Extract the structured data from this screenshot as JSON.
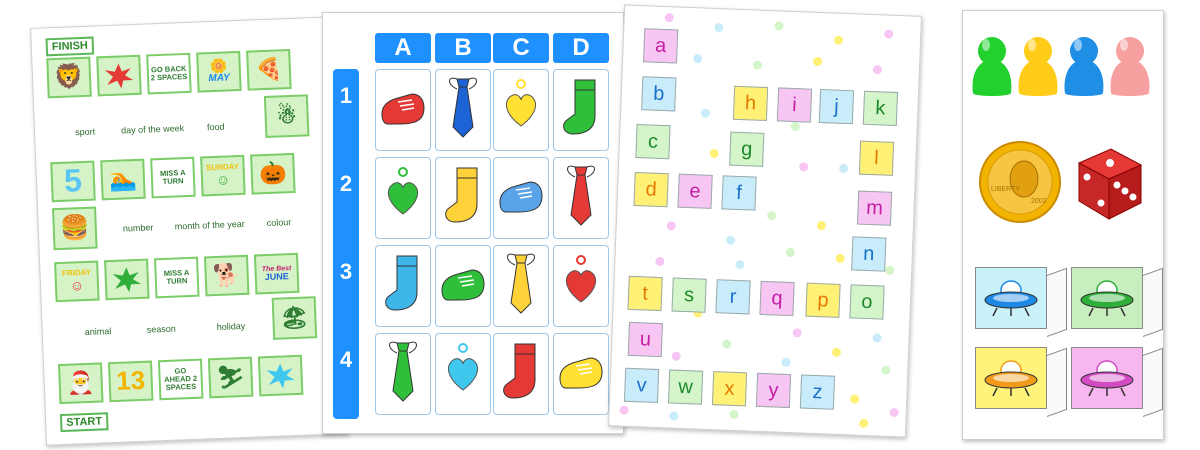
{
  "board": {
    "finish": "FINISH",
    "start": "START",
    "squares": {
      "go_back": "GO BACK 2 SPACES",
      "may": "MAY",
      "five": "5",
      "miss1": "MISS A TURN",
      "sunday": "SUNDAY",
      "friday": "FRIDAY",
      "miss2": "MISS A TURN",
      "best_june_1": "The Best",
      "best_june_2": "JUNE",
      "thirteen": "13",
      "go_ahead": "GO AHEAD 2 SPACES"
    },
    "categories": {
      "sport": "sport",
      "day": "day of the week",
      "food": "food",
      "number": "number",
      "month": "month of the year",
      "colour": "colour",
      "animal": "animal",
      "season": "season",
      "holiday": "holiday"
    }
  },
  "grid": {
    "columns": [
      "A",
      "B",
      "C",
      "D"
    ],
    "rows": [
      "1",
      "2",
      "3",
      "4"
    ],
    "cells": [
      [
        {
          "item": "shoe",
          "color": "#e53935"
        },
        {
          "item": "tie",
          "color": "#1e63d6"
        },
        {
          "item": "heart",
          "color": "#ffe033"
        },
        {
          "item": "sock",
          "color": "#2fbf3a"
        }
      ],
      [
        {
          "item": "heart",
          "color": "#2fbf3a"
        },
        {
          "item": "sock",
          "color": "#ffd23a"
        },
        {
          "item": "shoe",
          "color": "#5aa3e8"
        },
        {
          "item": "tie",
          "color": "#e53935"
        }
      ],
      [
        {
          "item": "sock",
          "color": "#3fb6ea"
        },
        {
          "item": "shoe",
          "color": "#2fbf3a"
        },
        {
          "item": "tie",
          "color": "#ffd23a"
        },
        {
          "item": "heart",
          "color": "#e53935"
        }
      ],
      [
        {
          "item": "tie",
          "color": "#2fbf3a"
        },
        {
          "item": "heart",
          "color": "#3fc7ee"
        },
        {
          "item": "sock",
          "color": "#e53935"
        },
        {
          "item": "shoe",
          "color": "#ffe033"
        }
      ]
    ]
  },
  "alphabet": {
    "letters": [
      {
        "ch": "a",
        "bg": "#f8c6f3",
        "fg": "#c21fa5"
      },
      {
        "ch": "b",
        "bg": "#c9ecfb",
        "fg": "#1b70c9"
      },
      {
        "ch": "c",
        "bg": "#d3f5c9",
        "fg": "#1c8a2a"
      },
      {
        "ch": "d",
        "bg": "#fff176",
        "fg": "#e67a00"
      },
      {
        "ch": "e",
        "bg": "#f8c6f3",
        "fg": "#c21fa5"
      },
      {
        "ch": "f",
        "bg": "#c9ecfb",
        "fg": "#1b70c9"
      },
      {
        "ch": "g",
        "bg": "#d3f5c9",
        "fg": "#1c8a2a"
      },
      {
        "ch": "h",
        "bg": "#fff176",
        "fg": "#e67a00"
      },
      {
        "ch": "i",
        "bg": "#f8c6f3",
        "fg": "#c21fa5"
      },
      {
        "ch": "j",
        "bg": "#c9ecfb",
        "fg": "#1b70c9"
      },
      {
        "ch": "k",
        "bg": "#d3f5c9",
        "fg": "#1c8a2a"
      },
      {
        "ch": "l",
        "bg": "#fff176",
        "fg": "#e67a00"
      },
      {
        "ch": "m",
        "bg": "#f8c6f3",
        "fg": "#c21fa5"
      },
      {
        "ch": "n",
        "bg": "#c9ecfb",
        "fg": "#1b70c9"
      },
      {
        "ch": "o",
        "bg": "#d3f5c9",
        "fg": "#1c8a2a"
      },
      {
        "ch": "p",
        "bg": "#fff176",
        "fg": "#e67a00"
      },
      {
        "ch": "q",
        "bg": "#f8c6f3",
        "fg": "#c21fa5"
      },
      {
        "ch": "r",
        "bg": "#c9ecfb",
        "fg": "#1b70c9"
      },
      {
        "ch": "s",
        "bg": "#d3f5c9",
        "fg": "#1c8a2a"
      },
      {
        "ch": "t",
        "bg": "#fff176",
        "fg": "#e67a00"
      },
      {
        "ch": "u",
        "bg": "#f8c6f3",
        "fg": "#c21fa5"
      },
      {
        "ch": "v",
        "bg": "#c9ecfb",
        "fg": "#1b70c9"
      },
      {
        "ch": "w",
        "bg": "#d3f5c9",
        "fg": "#1c8a2a"
      },
      {
        "ch": "x",
        "bg": "#fff176",
        "fg": "#e67a00"
      },
      {
        "ch": "y",
        "bg": "#f8c6f3",
        "fg": "#c21fa5"
      },
      {
        "ch": "z",
        "bg": "#c9ecfb",
        "fg": "#1b70c9"
      }
    ]
  },
  "pieces": {
    "pawn_colors": [
      "#22d12e",
      "#ffcc1a",
      "#1f8fe6",
      "#f7a0a0"
    ],
    "coin": {
      "top_text": "LIBERTY",
      "year": "2002"
    },
    "ship_backgrounds": [
      "#c9f2fb",
      "#c8eec0",
      "#fff37a",
      "#f7b6ef"
    ],
    "ship_colors": [
      "#1e88e5",
      "#2fae3a",
      "#f29b1b",
      "#d24bc2"
    ]
  }
}
